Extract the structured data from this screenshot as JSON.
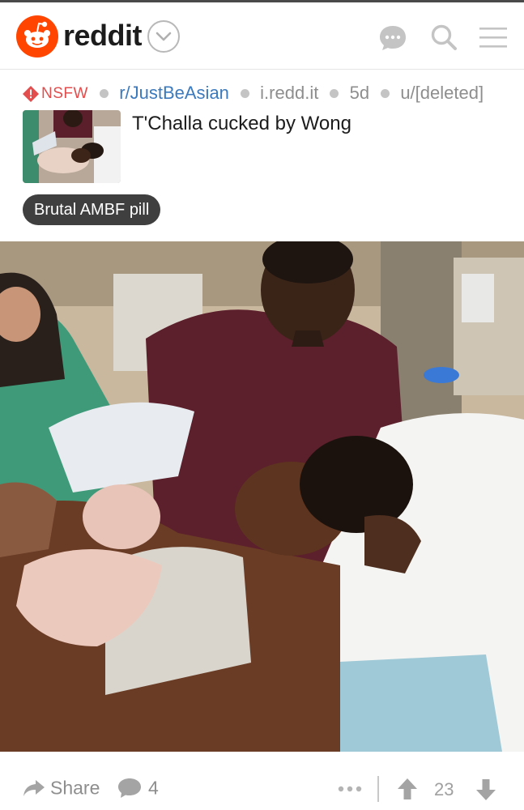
{
  "header": {
    "app_name": "reddit",
    "icons": {
      "logo": "reddit-snoo-logo",
      "dropdown": "chevron-down-icon",
      "chat": "chat-bubble-icon",
      "search": "search-icon",
      "menu": "hamburger-menu-icon"
    }
  },
  "post": {
    "nsfw_label": "NSFW",
    "subreddit": "r/JustBeAsian",
    "domain": "i.redd.it",
    "age": "5d",
    "author": "u/[deleted]",
    "title": "T'Challa cucked by Wong",
    "flair": "Brutal AMBF pill"
  },
  "footer": {
    "share_label": "Share",
    "comment_count": "4",
    "score": "23",
    "icons": {
      "share": "share-arrow-icon",
      "comments": "comment-bubble-icon",
      "more": "more-dots-icon",
      "upvote": "upvote-arrow-icon",
      "downvote": "downvote-arrow-icon"
    }
  },
  "colors": {
    "brand": "#ff4500",
    "nsfw": "#e24d4d",
    "subreddit_link": "#3c7abd",
    "muted": "#8e8e8e",
    "flair_bg": "#3f3f3f"
  }
}
